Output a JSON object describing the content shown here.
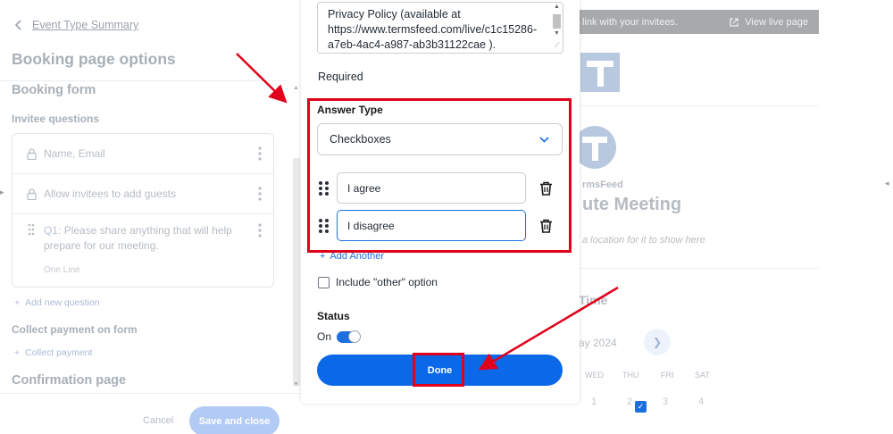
{
  "left_panel": {
    "back_label": "Event Type Summary",
    "page_title": "Booking page options",
    "booking_form_heading": "Booking form",
    "invitee_questions_heading": "Invitee questions",
    "questions": [
      {
        "label": "Name, Email",
        "icon": "lock-icon"
      },
      {
        "label": "Allow invitees to add guests",
        "icon": "lock-icon"
      },
      {
        "label_prefix": "Q1:",
        "label": "Please share anything that will help prepare for our meeting.",
        "sub": "One Line",
        "icon": "drag-handle-icon"
      }
    ],
    "add_question": "Add new question",
    "collect_payment_heading": "Collect payment on form",
    "collect_payment": "Collect payment",
    "confirmation_heading": "Confirmation page",
    "cancel_label": "Cancel",
    "save_label": "Save and close"
  },
  "modal": {
    "textarea_value": "Privacy Policy (available at https://www.termsfeed.com/live/c1c15286-a7eb-4ac4-a987-ab3b31122cae ).",
    "required_label": "Required",
    "required_checked": true,
    "answer_type_label": "Answer Type",
    "answer_type_value": "Checkboxes",
    "options": [
      "I agree",
      "I disagree"
    ],
    "add_another": "Add Another",
    "other_option_label": "Include \"other\" option",
    "other_option_checked": false,
    "status_label": "Status",
    "status_value": "On",
    "done_label": "Done"
  },
  "preview": {
    "banner_text": "link with your invitees.",
    "view_live": "View live page",
    "company": "rmsFeed",
    "meeting_title": "ute Meeting",
    "location_hint": "a location for it to show here",
    "time_heading": "Time",
    "month": "ay 2024",
    "weekdays": [
      "WED",
      "THU",
      "FRI",
      "SAT"
    ],
    "days": [
      "1",
      "2",
      "3",
      "4"
    ]
  },
  "colors": {
    "accent": "#0b69e8",
    "annotation_red": "#e0001b"
  }
}
